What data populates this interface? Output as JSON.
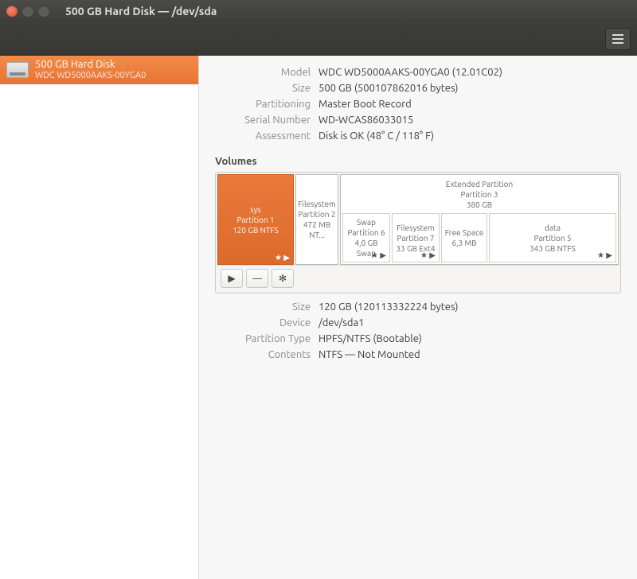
{
  "window": {
    "title": "500 GB Hard Disk — /dev/sda"
  },
  "sidebar": {
    "items": [
      {
        "title": "500 GB Hard Disk",
        "subtitle": "WDC WD5000AAKS-00YGA0"
      }
    ]
  },
  "disk": {
    "model_label": "Model",
    "model": "WDC WD5000AAKS-00YGA0 (12.01C02)",
    "size_label": "Size",
    "size": "500 GB (500107862016 bytes)",
    "partitioning_label": "Partitioning",
    "partitioning": "Master Boot Record",
    "serial_label": "Serial Number",
    "serial": "WD-WCAS86033015",
    "assess_label": "Assessment",
    "assess": "Disk is OK (48° C / 118° F)"
  },
  "volumes_heading": "Volumes",
  "volumes": {
    "p1": {
      "name": "sys",
      "line2": "Partition 1",
      "line3": "120 GB NTFS"
    },
    "p2": {
      "name": "Filesystem",
      "line2": "Partition 2",
      "line3": "472 MB NT..."
    },
    "ext": {
      "name": "Extended Partition",
      "line2": "Partition 3",
      "line3": "380 GB"
    },
    "p6": {
      "name": "Swap",
      "line2": "Partition 6",
      "line3": "4,0 GB Swap"
    },
    "p7": {
      "name": "Filesystem",
      "line2": "Partition 7",
      "line3": "33 GB Ext4"
    },
    "free": {
      "name": "Free Space",
      "line2": "6,3 MB"
    },
    "p5": {
      "name": "data",
      "line2": "Partition 5",
      "line3": "343 GB NTFS"
    }
  },
  "partition": {
    "size_label": "Size",
    "size": "120 GB (120113332224 bytes)",
    "device_label": "Device",
    "device": "/dev/sda1",
    "type_label": "Partition Type",
    "type": "HPFS/NTFS (Bootable)",
    "contents_label": "Contents",
    "contents": "NTFS — Not Mounted"
  },
  "icons": {
    "play": "▶",
    "minus": "—",
    "gear": "✻",
    "starplay": "★ ▶"
  }
}
